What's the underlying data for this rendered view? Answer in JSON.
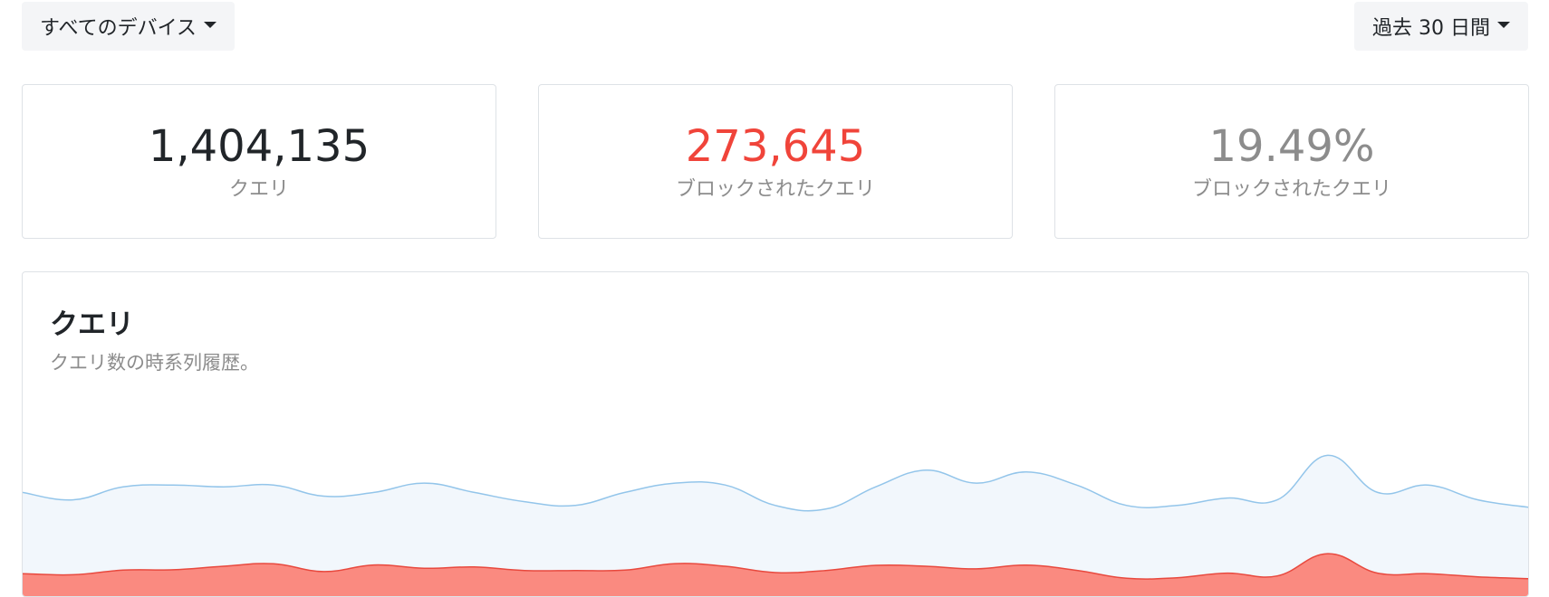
{
  "filters": {
    "device_label": "すべてのデバイス",
    "range_label": "過去 30 日間"
  },
  "stats": [
    {
      "value": "1,404,135",
      "label": "クエリ",
      "color": "#212529"
    },
    {
      "value": "273,645",
      "label": "ブロックされたクエリ",
      "color": "#f0443a"
    },
    {
      "value": "19.49%",
      "label": "ブロックされたクエリ",
      "color": "#8c8c8c"
    }
  ],
  "chart": {
    "title": "クエリ",
    "subtitle": "クエリ数の時系列履歴。"
  },
  "chart_data": {
    "type": "area",
    "series": [
      {
        "values": [
          52000,
          48000,
          55000,
          56000,
          55000,
          56000,
          50000,
          52000,
          57000,
          52000,
          47000,
          45000,
          52000,
          57000,
          56000,
          45000,
          43000,
          55000,
          64000,
          57000,
          63000,
          56000,
          45000,
          45000,
          49000,
          48000,
          72000,
          52000,
          56000,
          48000,
          44000
        ],
        "color": "#93c5ea",
        "fill": "#f2f7fc"
      },
      {
        "values": [
          8200,
          7600,
          10100,
          10300,
          12200,
          13500,
          9300,
          12900,
          11100,
          11800,
          9900,
          9900,
          10100,
          13600,
          12200,
          8800,
          9900,
          12700,
          12200,
          10800,
          12800,
          10000,
          5700,
          6000,
          8500,
          7000,
          19000,
          8500,
          8200,
          6500,
          5500
        ],
        "color": "#e8493e",
        "fill": "#fa8a80"
      }
    ]
  }
}
